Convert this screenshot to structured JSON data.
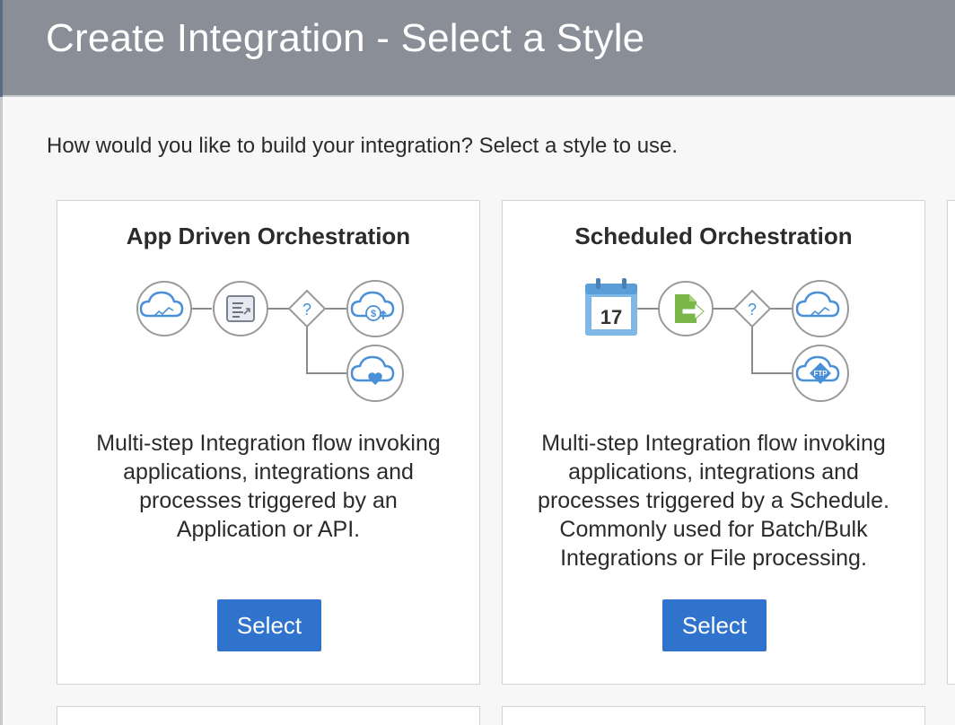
{
  "dialog": {
    "title": "Create Integration - Select a Style",
    "prompt": "How would you like to build your integration? Select a style to use."
  },
  "cards": [
    {
      "title": "App Driven Orchestration",
      "description_lines": [
        "Multi-step Integration flow invoking",
        "applications, integrations and",
        "processes triggered by an",
        "Application or API."
      ],
      "select_label": "Select",
      "diagram_icons": [
        "cloud-trigger-icon",
        "mapper-icon",
        "switch-icon",
        "cloud-dollar-icon",
        "cloud-heart-icon"
      ],
      "icon_text": {
        "switch": "?",
        "dollar": "$"
      }
    },
    {
      "title": "Scheduled Orchestration",
      "description_lines": [
        "Multi-step Integration flow invoking",
        "applications, integrations and",
        "processes triggered by a Schedule.",
        "Commonly used for Batch/Bulk",
        "Integrations or File processing."
      ],
      "select_label": "Select",
      "diagram_icons": [
        "calendar-icon",
        "file-export-icon",
        "switch-icon",
        "cloud-icon",
        "cloud-ftp-icon"
      ],
      "icon_text": {
        "calendar_day": "17",
        "switch": "?",
        "ftp": "FTP"
      }
    }
  ],
  "colors": {
    "header_bg": "#8a8e96",
    "button_bg": "#2f73cc",
    "icon_blue": "#4a90d9",
    "icon_green": "#7ab648",
    "node_border": "#9a9a9a"
  }
}
